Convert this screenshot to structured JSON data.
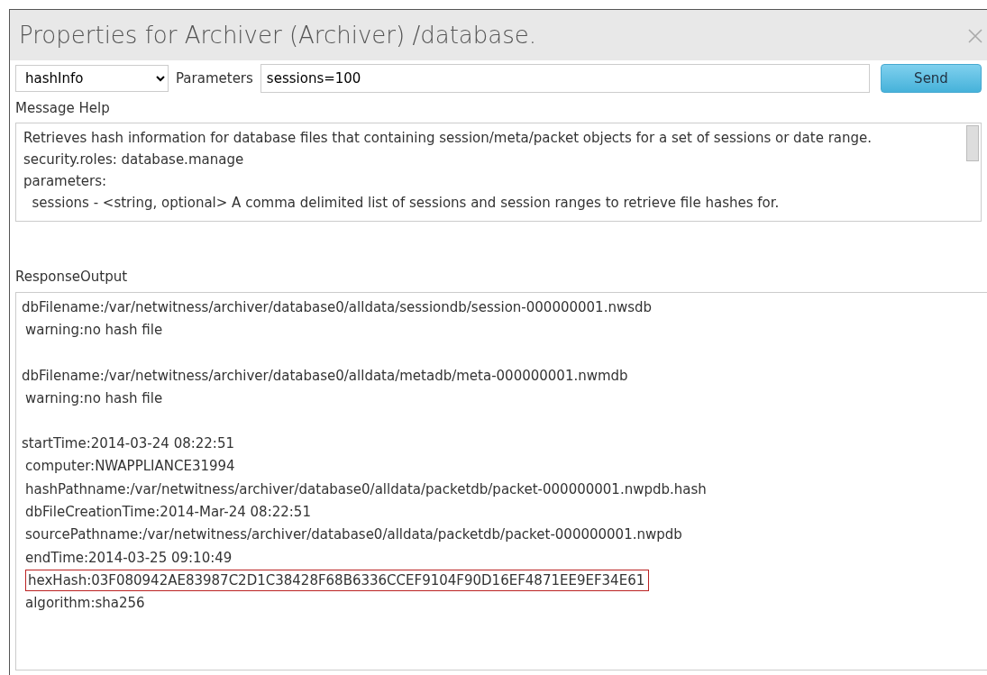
{
  "window": {
    "title": "Properties for Archiver (Archiver) /database."
  },
  "command": {
    "value": "hashInfo"
  },
  "parameters": {
    "label": "Parameters",
    "value": "sessions=100"
  },
  "send_button": "Send",
  "message_help": {
    "label": "Message Help",
    "lines": [
      "Retrieves hash information for database files that containing session/meta/packet objects for a set of sessions or date range.",
      "security.roles: database.manage",
      "parameters:",
      "  sessions - <string, optional> A comma delimited list of sessions and session ranges to retrieve file hashes for."
    ]
  },
  "response": {
    "label": "ResponseOutput",
    "blocks": [
      {
        "lines": [
          {
            "text": "dbFilename:/var/netwitness/archiver/database0/alldata/sessiondb/session-000000001.nwsdb",
            "highlighted": false
          },
          {
            "text": "warning:no hash file",
            "highlighted": false
          }
        ]
      },
      {
        "lines": [
          {
            "text": "dbFilename:/var/netwitness/archiver/database0/alldata/metadb/meta-000000001.nwmdb",
            "highlighted": false
          },
          {
            "text": "warning:no hash file",
            "highlighted": false
          }
        ]
      },
      {
        "lines": [
          {
            "text": "startTime:2014-03-24 08:22:51",
            "highlighted": false
          },
          {
            "text": "computer:NWAPPLIANCE31994",
            "highlighted": false
          },
          {
            "text": "hashPathname:/var/netwitness/archiver/database0/alldata/packetdb/packet-000000001.nwpdb.hash",
            "highlighted": false
          },
          {
            "text": "dbFileCreationTime:2014-Mar-24 08:22:51",
            "highlighted": false
          },
          {
            "text": "sourcePathname:/var/netwitness/archiver/database0/alldata/packetdb/packet-000000001.nwpdb",
            "highlighted": false
          },
          {
            "text": "endTime:2014-03-25 09:10:49",
            "highlighted": false
          },
          {
            "text": "hexHash:03F080942AE83987C2D1C38428F68B6336CCEF9104F90D16EF4871EE9EF34E61",
            "highlighted": true
          },
          {
            "text": "algorithm:sha256",
            "highlighted": false
          }
        ]
      }
    ]
  }
}
